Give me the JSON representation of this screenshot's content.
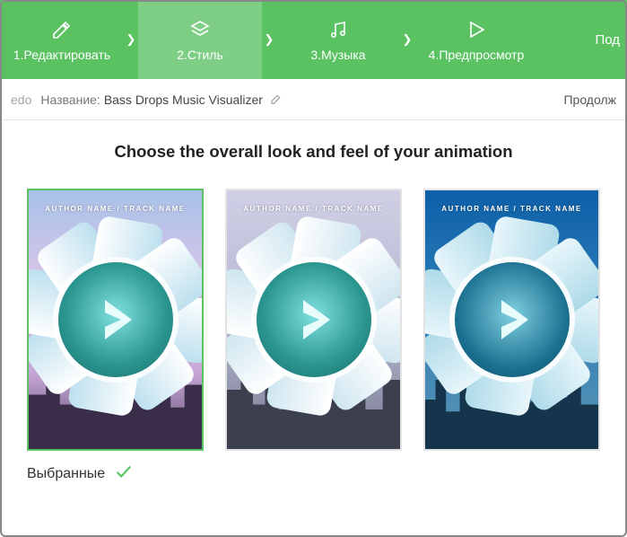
{
  "header": {
    "steps": [
      {
        "label": "1.Редактировать"
      },
      {
        "label": "2.Стиль"
      },
      {
        "label": "3.Музыка"
      },
      {
        "label": "4.Предпросмотр"
      }
    ],
    "right_label": "Под"
  },
  "subbar": {
    "undo_fragment": "edo",
    "name_label": "Название:",
    "name_value": "Bass Drops Music Visualizer",
    "continue_label": "Продолж"
  },
  "main": {
    "title": "Choose the overall look and feel of your animation",
    "card_text": "AUTHOR NAME / TRACK NAME",
    "selected_label": "Выбранные"
  }
}
